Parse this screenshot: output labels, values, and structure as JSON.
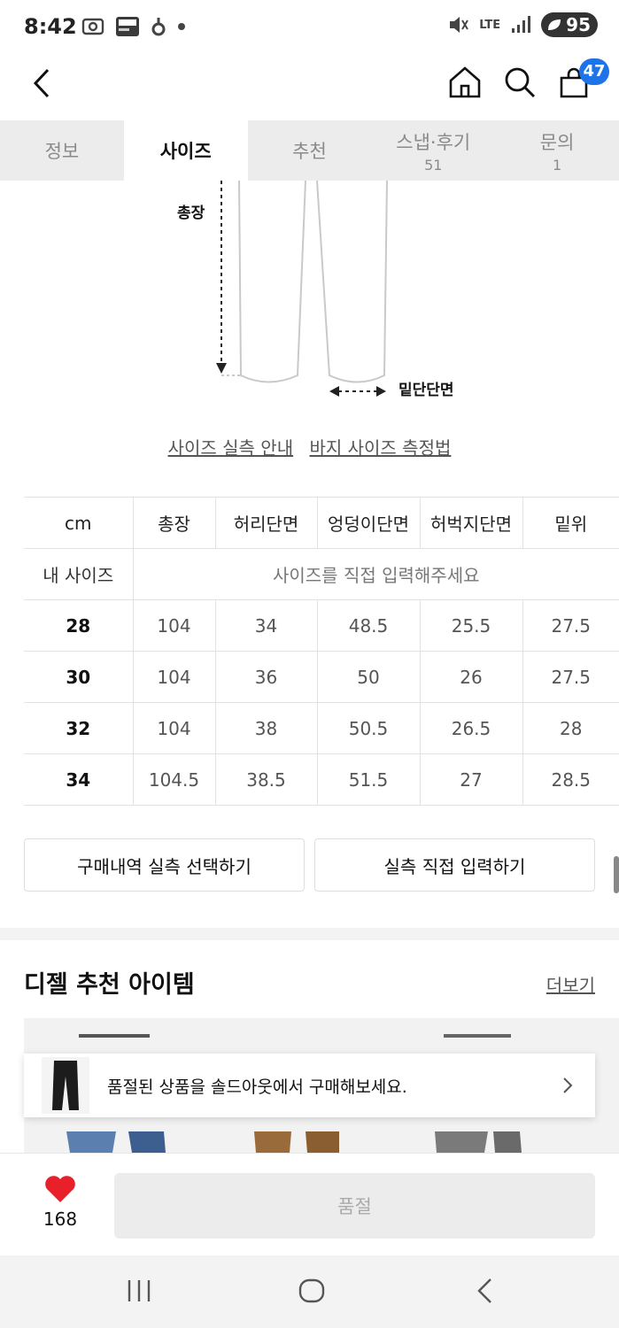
{
  "status_bar": {
    "time": "8:42",
    "battery": "95",
    "network": "LTE"
  },
  "header": {
    "cart_count": "47",
    "icons": [
      "back-icon",
      "home-icon",
      "search-icon",
      "cart-icon"
    ]
  },
  "tabs": [
    {
      "label": "정보",
      "count": ""
    },
    {
      "label": "사이즈",
      "count": ""
    },
    {
      "label": "추천",
      "count": ""
    },
    {
      "label": "스냅·후기",
      "count": "51"
    },
    {
      "label": "문의",
      "count": "1"
    }
  ],
  "diagram": {
    "length_label": "총장",
    "hem_label": "밑단단면"
  },
  "links": {
    "size_guide": "사이즈 실측 안내",
    "measure_guide": "바지 사이즈 측정법"
  },
  "size_table": {
    "headers": [
      "cm",
      "총장",
      "허리단면",
      "엉덩이단면",
      "허벅지단면",
      "밑위"
    ],
    "my_size_label": "내 사이즈",
    "my_size_prompt": "사이즈를 직접 입력해주세요",
    "rows": [
      {
        "size": "28",
        "values": [
          "104",
          "34",
          "48.5",
          "25.5",
          "27.5"
        ]
      },
      {
        "size": "30",
        "values": [
          "104",
          "36",
          "50",
          "26",
          "27.5"
        ]
      },
      {
        "size": "32",
        "values": [
          "104",
          "38",
          "50.5",
          "26.5",
          "28"
        ]
      },
      {
        "size": "34",
        "values": [
          "104.5",
          "38.5",
          "51.5",
          "27",
          "28.5"
        ]
      }
    ]
  },
  "actions": {
    "purchase_history": "구매내역 실측 선택하기",
    "direct_input": "실측 직접 입력하기"
  },
  "recommend": {
    "title": "디젤 추천 아이템",
    "more": "더보기"
  },
  "soldout_banner": {
    "text": "품절된 상품을 솔드아웃에서 구매해보세요."
  },
  "bottom_bar": {
    "like_count": "168",
    "buy_label": "품절"
  },
  "colors": {
    "accent_blue": "#1e73e8",
    "heart_red": "#e8202a"
  }
}
